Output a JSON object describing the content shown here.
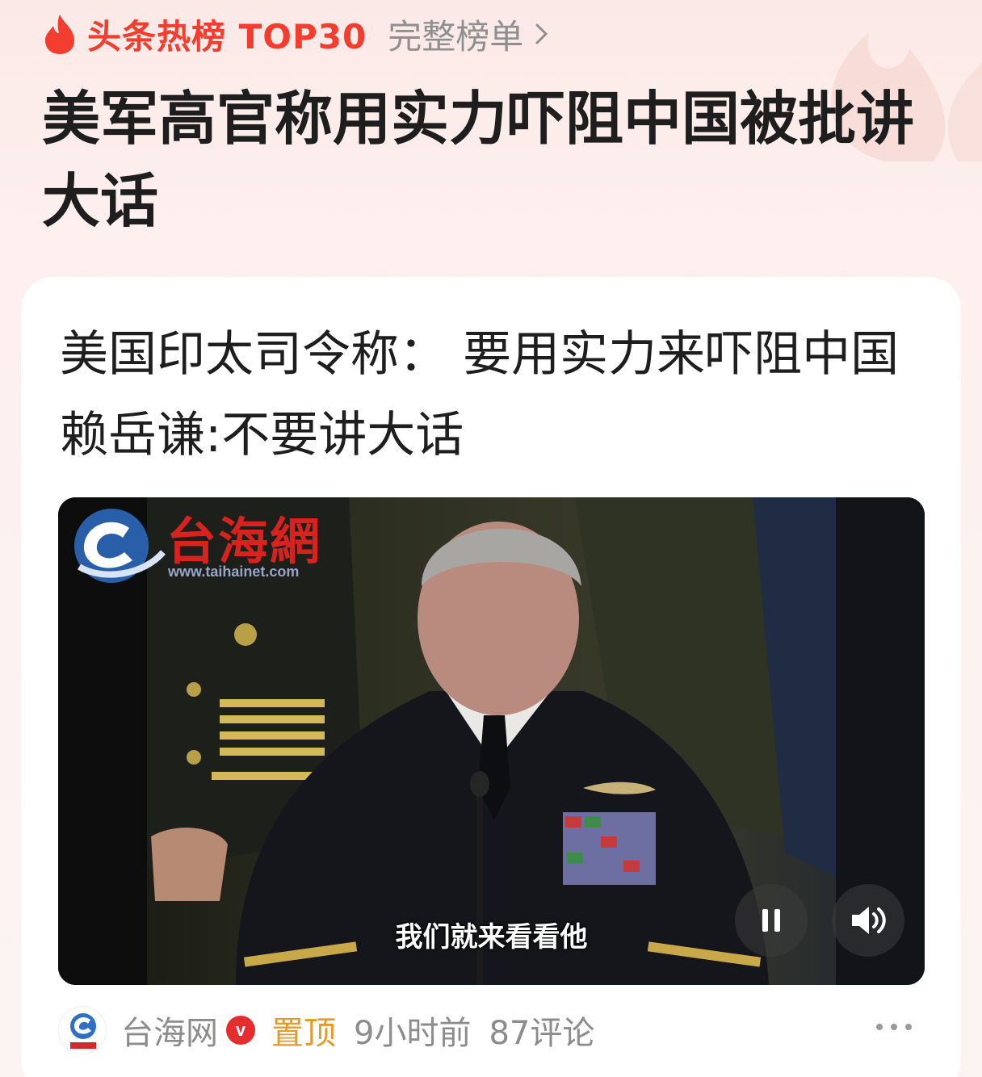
{
  "header": {
    "hot_title": "头条热榜 TOP30",
    "full_list_label": "完整榜单"
  },
  "headline": "美军高官称用实力吓阻中国被批讲大话",
  "card": {
    "title": "美国印太司令称：  要用实力来吓阻中国 赖岳谦:不要讲大话",
    "video": {
      "watermark_text": "台海網",
      "watermark_url": "www.taihainet.com",
      "subtitle": "我们就来看看他",
      "state": "playing"
    },
    "footer": {
      "source": "台海网",
      "verified_badge": "v",
      "pinned": "置顶",
      "time": "9小时前",
      "comments": "87评论"
    }
  },
  "colors": {
    "accent": "#f23d2f",
    "pinned": "#e59a2a",
    "muted": "#8c8c8c"
  }
}
